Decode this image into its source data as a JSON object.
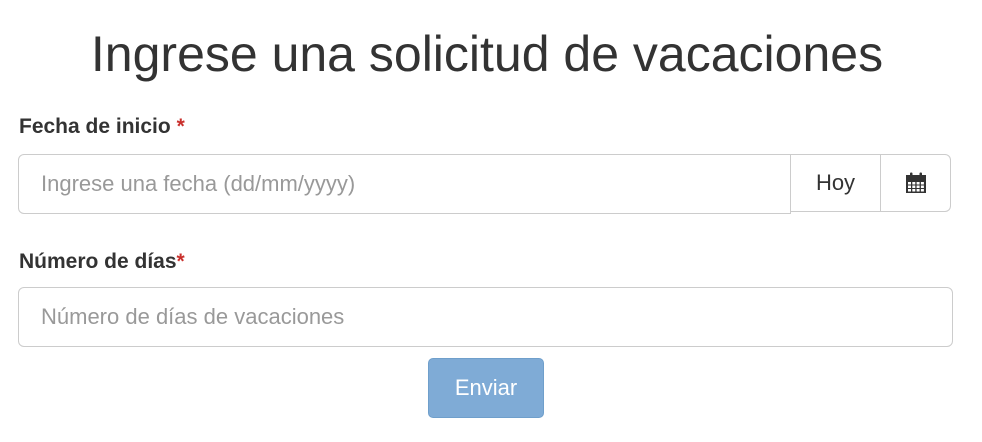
{
  "form": {
    "title": "Ingrese una solicitud de vacaciones",
    "start_date": {
      "label": "Fecha de inicio",
      "required_mark": "*",
      "placeholder": "Ingrese una fecha (dd/mm/yyyy)",
      "value": "",
      "today_button": "Hoy",
      "calendar_icon": "calendar-icon"
    },
    "days": {
      "label": "Número de días",
      "required_mark": "*",
      "placeholder": "Número de días de vacaciones",
      "value": ""
    },
    "submit_label": "Enviar",
    "submit_disabled": true
  },
  "colors": {
    "text": "#333333",
    "required": "#c9302c",
    "border": "#cccccc",
    "submit_bg": "#7fabd6",
    "placeholder": "#999999"
  }
}
